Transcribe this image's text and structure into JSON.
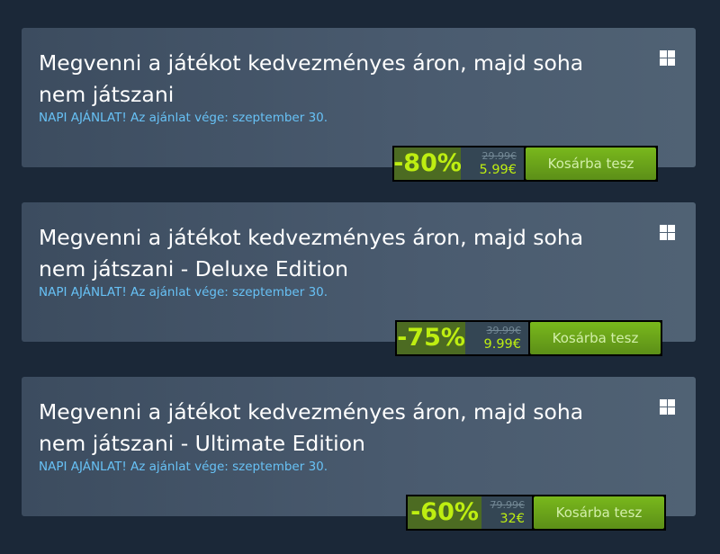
{
  "offers": [
    {
      "title": "Megvenni a játékot kedvezményes áron, majd soha nem játszani",
      "expiry": "NAPI AJÁNLAT! Az ajánlat vége: szeptember 30.",
      "discount": "-80%",
      "original_price": "29.99€",
      "final_price": "5.99€",
      "button_label": "Kosárba tesz",
      "platform_icon": "windows-icon"
    },
    {
      "title": "Megvenni a játékot kedvezményes áron, majd soha nem játszani - Deluxe Edition",
      "expiry": "NAPI AJÁNLAT! Az ajánlat vége: szeptember 30.",
      "discount": "-75%",
      "original_price": "39.99€",
      "final_price": "9.99€",
      "button_label": "Kosárba tesz",
      "platform_icon": "windows-icon"
    },
    {
      "title": "Megvenni a játékot kedvezményes áron, majd soha nem játszani - Ultimate Edition",
      "expiry": "NAPI AJÁNLAT! Az ajánlat vége: szeptember 30.",
      "discount": "-60%",
      "original_price": "79.99€",
      "final_price": "32€",
      "button_label": "Kosárba tesz",
      "platform_icon": "windows-icon"
    }
  ],
  "colors": {
    "background": "#1b2838",
    "card": "#4a5b6f",
    "discount_bg": "#4c6b22",
    "discount_text": "#beee11",
    "link_blue": "#67c1f5",
    "button_green": "#79b81c"
  }
}
